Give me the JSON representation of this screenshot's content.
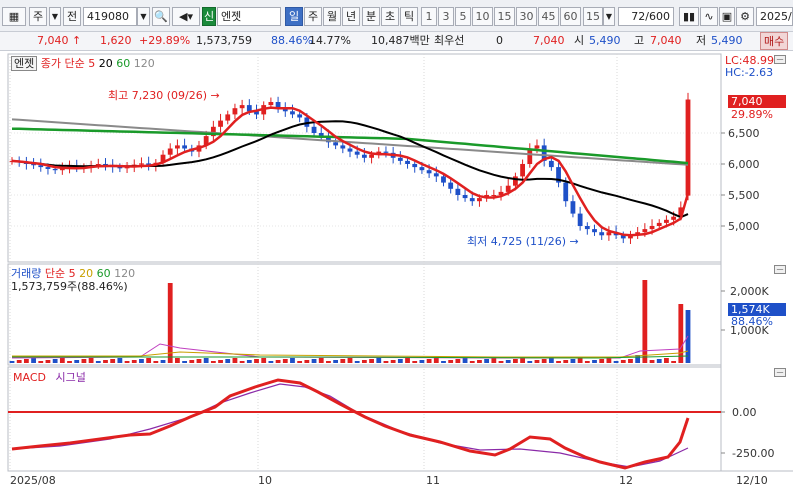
{
  "toolbar": {
    "code_prefix": "주",
    "jeon": "전",
    "code": "419080",
    "stock_badge": "신",
    "stock_name": "엔젯",
    "periods": [
      "일",
      "주",
      "월",
      "년"
    ],
    "active_period": "일",
    "intraday": [
      "분",
      "초",
      "틱"
    ],
    "minutes": [
      "1",
      "3",
      "5",
      "10",
      "15",
      "30",
      "45",
      "60"
    ],
    "minute_value": "15",
    "page_counter": "72/600",
    "date_value": "2025/"
  },
  "quote": {
    "price": "7,040",
    "arrow": "↑",
    "change": "1,620",
    "change_pct": "+29.89%",
    "volume": "1,573,759",
    "vol_ratio": "88.46%",
    "turnover": "14.77%",
    "amount": "10,487백만",
    "preferred_label": "최우선",
    "preferred_value": "0",
    "ask_price": "7,040",
    "open_label": "시",
    "open": "5,490",
    "high_label": "고",
    "high": "7,040",
    "low_label": "저",
    "low": "5,490",
    "trade_tab": "매수"
  },
  "price_panel": {
    "name_tag": "엔젯",
    "ma_label": "종가 단순",
    "ma_periods": [
      "5",
      "20",
      "60",
      "120"
    ],
    "lc": "LC:48.99",
    "hc": "HC:-2.63",
    "high_note": "최고 7,230 (09/26)",
    "low_note": "최저 4,725 (11/26)",
    "current_price_box": "7,040",
    "current_change_pct": "29.89%",
    "axis_ticks": [
      "6,500",
      "6,000",
      "5,500",
      "5,000"
    ]
  },
  "volume_panel": {
    "label": "거래량",
    "ma_label": "단순",
    "ma_periods": [
      "5",
      "20",
      "60",
      "120"
    ],
    "current": "1,573,759주(88.46%)",
    "volume_box": "1,574K",
    "volume_pct": "88.46%",
    "axis_ticks": [
      "2,000K",
      "1,000K"
    ]
  },
  "macd_panel": {
    "label_macd": "MACD",
    "label_signal": "시그널",
    "axis_ticks": [
      "0.00",
      "-250.00"
    ]
  },
  "x_axis": {
    "labels": [
      "2025/08",
      "10",
      "11",
      "12",
      "12/10"
    ]
  },
  "colors": {
    "up": "#e02020",
    "down": "#1e50c8",
    "ma5": "#e02020",
    "ma20": "#000000",
    "ma60": "#1a9a2a",
    "ma120": "#8a8a8a",
    "macd": "#e02020",
    "signal": "#8a2aa8"
  }
}
